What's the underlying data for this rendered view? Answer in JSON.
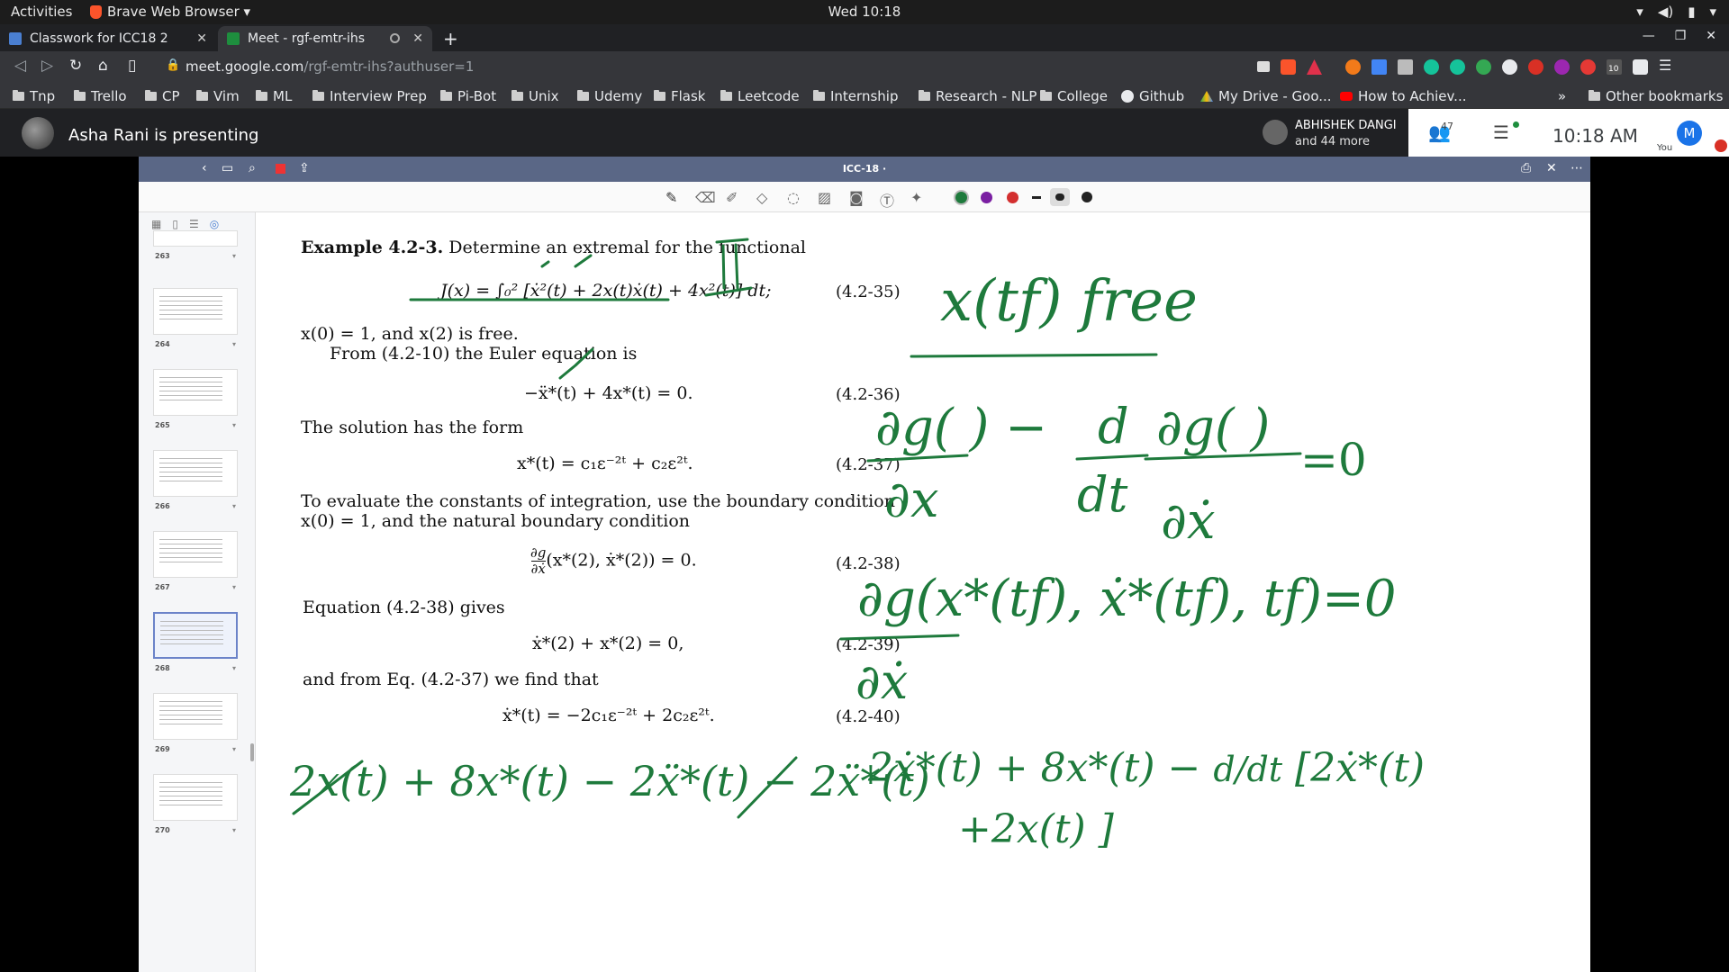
{
  "system": {
    "activities": "Activities",
    "app_name": "Brave Web Browser ▾",
    "clock": "Wed 10:18"
  },
  "tabs": [
    {
      "title": "Classwork for ICC18 2",
      "color": "#4a7fd1"
    },
    {
      "title": "Meet - rgf-emtr-ihs",
      "color": "#1e8e3e"
    }
  ],
  "address": {
    "host": "meet.google.com",
    "path": "/rgf-emtr-ihs?authuser=1"
  },
  "bookmarks": [
    "Tnp",
    "Trello",
    "CP",
    "Vim",
    "ML",
    "Interview Prep",
    "Pi-Bot",
    "Unix",
    "Udemy",
    "Flask",
    "Leetcode",
    "Internship",
    "Research - NLP",
    "College",
    "Github",
    "My Drive - Goo...",
    "How to Achiev..."
  ],
  "bookmarks_overflow": "»",
  "other_bookmarks": "Other bookmarks",
  "extension_badge": "10",
  "meet": {
    "presenting": "Asha Rani is presenting",
    "participant_name": "ABHISHEK DANGI",
    "participant_more": "and 44 more",
    "people_count": "47",
    "time": "10:18 AM",
    "you_initial": "M",
    "you_label": "You"
  },
  "viewer": {
    "title": "ICC-18 ·",
    "colors": [
      "#1e7a3c",
      "#7a1fa2",
      "#d32f2f"
    ]
  },
  "pages": [
    "263",
    "264",
    "265",
    "266",
    "267",
    "268",
    "269",
    "270"
  ],
  "selected_page": "268",
  "doc": {
    "example_heading": "Example 4.2-3.",
    "example_text": " Determine an extremal for the functional",
    "eq35": "J(x) = ∫₀² [ẋ²(t) + 2x(t)ẋ(t) + 4x²(t)] dt;",
    "eq35_num": "(4.2-35)",
    "bc": "x(0) = 1, and x(2) is free.",
    "euler": "From (4.2-10) the Euler equation is",
    "eq36": "−ẍ*(t) + 4x*(t) = 0.",
    "eq36_num": "(4.2-36)",
    "sol_form": "The solution has the form",
    "eq37": "x*(t) = c₁ε⁻²ᵗ + c₂ε²ᵗ.",
    "eq37_num": "(4.2-37)",
    "eval1": "To evaluate the constants of integration, use the boundary condition",
    "eval2": "x(0) = 1, and the natural boundary condition",
    "eq38_num": "(4.2-38)",
    "eq38_rest": "(x*(2), ẋ*(2)) = 0.",
    "gives": "Equation (4.2-38) gives",
    "eq39": "ẋ*(2) + x*(2) = 0,",
    "eq39_num": "(4.2-39)",
    "from37": "and from Eq. (4.2-37) we find that",
    "eq40": "ẋ*(t) = −2c₁ε⁻²ᵗ + 2c₂ε²ᵗ.",
    "eq40_num": "(4.2-40)"
  },
  "handwriting": {
    "roman": "II",
    "free": "x(tf) free",
    "eq_zero": "=0",
    "bottom_left": "2x(t) + 8x*(t) − 2ẍ*(t) − 2ẍ*(t)",
    "bottom_right": "2ẋ*(t) + 8x*(t) − d/dt [2ẋ*(t) + 2x(t)]"
  }
}
